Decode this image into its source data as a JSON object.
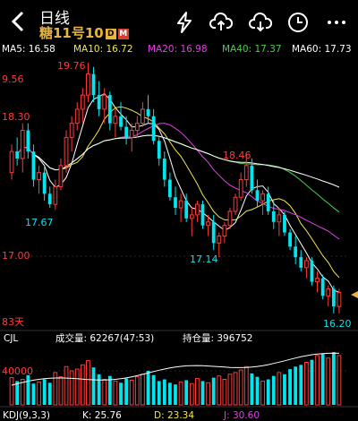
{
  "header": {
    "title": "日线",
    "subtitle": "糖11号10",
    "tag_d": "D",
    "tag_m": "M"
  },
  "icons": [
    "back-arrow-icon",
    "flash-icon",
    "cloud-upload-icon",
    "cloud-download-icon",
    "clock-icon",
    "more-icon"
  ],
  "ma": [
    {
      "label": "MA5: 16.58",
      "color": "#ffffff"
    },
    {
      "label": "MA10: 16.72",
      "color": "#f2e84b"
    },
    {
      "label": "MA20: 16.98",
      "color": "#e040e0"
    },
    {
      "label": "MA40: 17.37",
      "color": "#4bd04b"
    },
    {
      "label": "MA60: 17.73",
      "color": "#ffffff"
    }
  ],
  "price_labels": {
    "high_mark": "19.76",
    "left_top": "9.56",
    "left_mid": "18.30",
    "low_mark1": "17.67",
    "mid_high": "18.46",
    "low_mark2": "17.14",
    "axis_1700": "17.00",
    "low_mark3": "16.20",
    "days": "83天"
  },
  "lower": {
    "indicator": "CJL",
    "volume": "成交量: 62267(47:53)",
    "open_interest": "持仓量: 396752",
    "axis_40000": "40000"
  },
  "kdj": {
    "label": "KDJ(9,3,3)",
    "k": "K: 25.76",
    "d": "D: 23.34",
    "j": "J: 30.60"
  },
  "colors": {
    "up": "#ff3b3b",
    "down": "#00e5ee",
    "ma5": "#ffffff",
    "ma10": "#f2e84b",
    "ma20": "#e040e0",
    "ma40": "#4bd04b",
    "ma60": "#ffffff",
    "accent": "#e8b43a"
  },
  "chart_data": {
    "type": "candlestick",
    "y_scale_ref": {
      "price_at_1700": 17.0
    },
    "candles": [
      [
        18.2,
        18.6,
        18.1,
        18.5
      ],
      [
        18.5,
        18.7,
        18.3,
        18.4
      ],
      [
        18.4,
        18.9,
        18.2,
        18.8
      ],
      [
        18.8,
        18.9,
        18.4,
        18.5
      ],
      [
        18.5,
        18.6,
        18.0,
        18.1
      ],
      [
        18.1,
        18.3,
        17.9,
        18.2
      ],
      [
        18.2,
        18.3,
        17.8,
        17.9
      ],
      [
        17.9,
        18.0,
        17.7,
        17.75
      ],
      [
        17.75,
        18.1,
        17.67,
        18.0
      ],
      [
        18.0,
        18.4,
        17.95,
        18.3
      ],
      [
        18.3,
        18.8,
        18.2,
        18.7
      ],
      [
        18.7,
        19.0,
        18.5,
        18.9
      ],
      [
        18.9,
        19.2,
        18.8,
        19.1
      ],
      [
        19.1,
        19.4,
        18.9,
        19.3
      ],
      [
        19.3,
        19.76,
        19.2,
        19.6
      ],
      [
        19.6,
        19.7,
        19.2,
        19.3
      ],
      [
        19.3,
        19.5,
        19.0,
        19.1
      ],
      [
        19.1,
        19.4,
        18.9,
        19.3
      ],
      [
        19.3,
        19.35,
        18.8,
        18.9
      ],
      [
        18.9,
        19.1,
        18.7,
        19.0
      ],
      [
        19.0,
        19.2,
        18.8,
        18.85
      ],
      [
        18.85,
        19.0,
        18.6,
        18.7
      ],
      [
        18.7,
        18.9,
        18.5,
        18.8
      ],
      [
        18.8,
        19.0,
        18.7,
        18.9
      ],
      [
        18.9,
        19.2,
        18.85,
        19.1
      ],
      [
        19.1,
        19.3,
        18.9,
        19.0
      ],
      [
        19.0,
        19.1,
        18.6,
        18.65
      ],
      [
        18.65,
        18.7,
        18.3,
        18.4
      ],
      [
        18.4,
        18.5,
        18.0,
        18.1
      ],
      [
        18.1,
        18.2,
        17.8,
        17.85
      ],
      [
        17.85,
        18.0,
        17.6,
        17.7
      ],
      [
        17.7,
        17.9,
        17.5,
        17.8
      ],
      [
        17.8,
        17.9,
        17.5,
        17.55
      ],
      [
        17.55,
        17.7,
        17.3,
        17.6
      ],
      [
        17.6,
        17.8,
        17.5,
        17.75
      ],
      [
        17.75,
        17.8,
        17.4,
        17.45
      ],
      [
        17.45,
        17.6,
        17.3,
        17.5
      ],
      [
        17.5,
        17.6,
        17.1,
        17.2
      ],
      [
        17.2,
        17.35,
        17.0,
        17.3
      ],
      [
        17.3,
        17.5,
        17.2,
        17.45
      ],
      [
        17.45,
        17.7,
        17.4,
        17.65
      ],
      [
        17.65,
        17.9,
        17.6,
        17.85
      ],
      [
        17.85,
        18.2,
        17.8,
        18.1
      ],
      [
        18.1,
        18.46,
        18.0,
        18.3
      ],
      [
        18.3,
        18.4,
        17.9,
        17.95
      ],
      [
        17.95,
        18.1,
        17.7,
        17.8
      ],
      [
        17.8,
        17.95,
        17.6,
        17.9
      ],
      [
        17.9,
        18.0,
        17.6,
        17.65
      ],
      [
        17.65,
        17.8,
        17.4,
        17.5
      ],
      [
        17.5,
        17.7,
        17.3,
        17.6
      ],
      [
        17.6,
        17.65,
        17.3,
        17.35
      ],
      [
        17.35,
        17.4,
        17.1,
        17.15
      ],
      [
        17.15,
        17.3,
        16.9,
        17.0
      ],
      [
        17.0,
        17.1,
        16.8,
        16.85
      ],
      [
        16.85,
        17.0,
        16.7,
        16.95
      ],
      [
        16.95,
        17.0,
        16.6,
        16.65
      ],
      [
        16.65,
        16.8,
        16.5,
        16.7
      ],
      [
        16.7,
        16.75,
        16.4,
        16.45
      ],
      [
        16.45,
        16.6,
        16.3,
        16.55
      ],
      [
        16.55,
        16.6,
        16.2,
        16.3
      ],
      [
        16.3,
        16.55,
        16.2,
        16.5
      ]
    ],
    "volumes": [
      32000,
      28000,
      30000,
      35000,
      25000,
      27000,
      30000,
      26000,
      38000,
      33000,
      45000,
      40000,
      42000,
      47000,
      52000,
      44000,
      36000,
      30000,
      34000,
      28000,
      26000,
      31000,
      29000,
      33000,
      36000,
      40000,
      35000,
      28000,
      30000,
      26000,
      24000,
      27000,
      29000,
      25000,
      31000,
      28000,
      26000,
      32000,
      34000,
      30000,
      36000,
      38000,
      41000,
      45000,
      37000,
      33000,
      28000,
      30000,
      34000,
      38000,
      36000,
      42000,
      45000,
      47000,
      50000,
      53000,
      58000,
      60000,
      55000,
      62000,
      58000
    ]
  }
}
